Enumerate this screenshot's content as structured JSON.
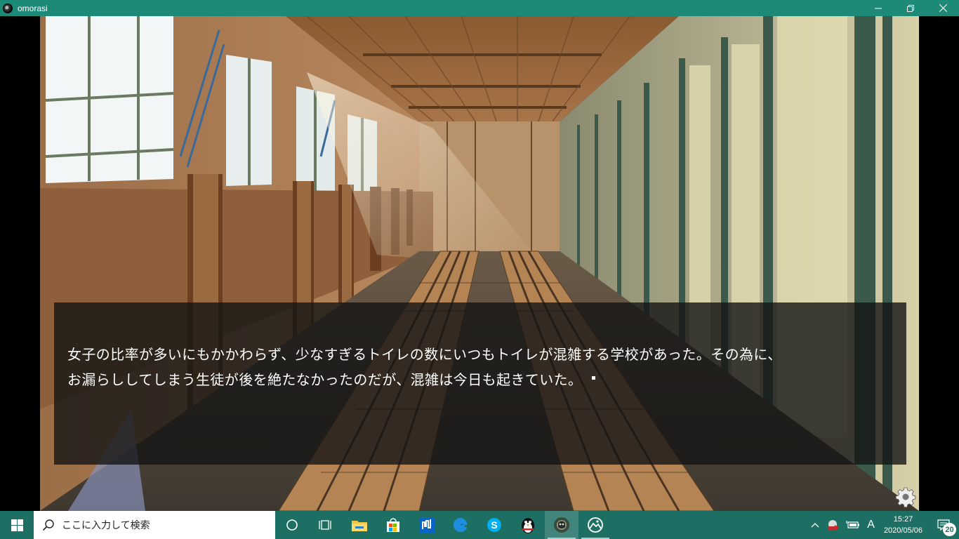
{
  "window": {
    "title": "omorasi"
  },
  "game": {
    "dialogue": {
      "line1": "女子の比率が多いにもかかわらず、少なすぎるトイレの数にいつもトイレが混雑する学校があった。その為に、",
      "line2": "お漏らししてしまう生徒が後を絶たなかったのだが、混雑は今日も起きていた。"
    },
    "settings_icon": "gear-icon"
  },
  "taskbar": {
    "search_placeholder": "ここに入力して検索",
    "pinned": [
      "cortana-icon",
      "task-view-icon",
      "file-explorer-icon",
      "store-icon",
      "app-icon",
      "edge-icon",
      "skype-icon",
      "penguin-app-icon",
      "game-app-icon",
      "photos-icon"
    ],
    "tray": {
      "ime_mode": "A",
      "time": "15:27",
      "date": "2020/05/06",
      "notification_count": "20"
    }
  },
  "colors": {
    "titlebar": "#1d8a78",
    "taskbar": "#1d6e63"
  }
}
